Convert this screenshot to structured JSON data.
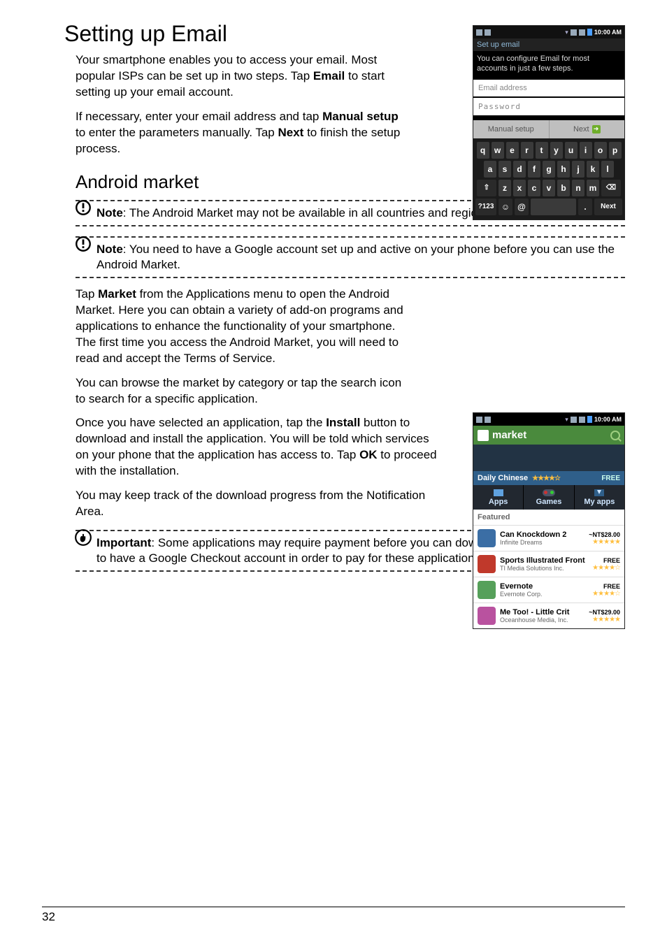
{
  "heading1": "Setting up Email",
  "email_p1_a": "Your smartphone enables you to access your email. Most popular ISPs can be set up in two steps. Tap ",
  "email_p1_b": "Email",
  "email_p1_c": " to start setting up your email account.",
  "email_p2_a": "If necessary, enter your email address and tap ",
  "email_p2_b": "Manual setup",
  "email_p2_c": " to enter the parameters manually. Tap ",
  "email_p2_d": "Next",
  "email_p2_e": " to finish the setup process.",
  "heading2": "Android market",
  "note1_label": "Note",
  "note1_body": ": The Android Market may not be available in all countries and regions.",
  "note2_label": "Note",
  "note2_body": ": You need to have a Google account set up and active on your phone before you can use the Android Market.",
  "market_p1_a": "Tap ",
  "market_p1_b": "Market",
  "market_p1_c": " from the Applications menu to open the Android Market. Here you can obtain a variety of add-on programs and applications to enhance the functionality of your smartphone. The first time you access the Android Market, you will need to read and accept the Terms of Service.",
  "market_p2": "You can browse the market by category or tap the search icon to search for a specific application.",
  "market_p3_a": "Once you have selected an application, tap the ",
  "market_p3_b": "Install",
  "market_p3_c": " button to download and install the application. You will be told which services on your phone that the application has access to. Tap ",
  "market_p3_d": "OK",
  "market_p3_e": " to proceed with the installation.",
  "market_p4": "You may keep track of the download progress from the Notification Area.",
  "important_label": "Important",
  "important_body": ": Some applications may require payment before you can download them. You will need to have a Google Checkout account in order to pay for these applications.",
  "page_number": "32",
  "phone1": {
    "time": "10:00 AM",
    "screen_title": "Set up email",
    "screen_msg": "You can configure Email for most accounts in just a few steps.",
    "field_email": "Email address",
    "field_password": "Password",
    "btn_manual": "Manual setup",
    "btn_next": "Next",
    "kbd": {
      "row1": [
        "q",
        "w",
        "e",
        "r",
        "t",
        "y",
        "u",
        "i",
        "o",
        "p"
      ],
      "row2": [
        "a",
        "s",
        "d",
        "f",
        "g",
        "h",
        "j",
        "k",
        "l"
      ],
      "row3": [
        "z",
        "x",
        "c",
        "v",
        "b",
        "n",
        "m"
      ],
      "sym": "?123",
      "at": "@",
      "period": ".",
      "next": "Next"
    }
  },
  "phone2": {
    "time": "10:00 AM",
    "title": "market",
    "feature": {
      "name": "Daily Chinese",
      "stars": "★★★★☆",
      "price": "FREE"
    },
    "tabs": {
      "apps": "Apps",
      "games": "Games",
      "myapps": "My apps"
    },
    "featured_label": "Featured",
    "apps": [
      {
        "name": "Can Knockdown 2",
        "publisher": "Infinite Dreams",
        "price": "~NT$28.00",
        "stars": "★★★★★",
        "color": "#3b6ea5"
      },
      {
        "name": "Sports Illustrated Front",
        "publisher": "TI Media Solutions Inc.",
        "price": "FREE",
        "stars": "★★★★☆",
        "color": "#c0392b"
      },
      {
        "name": "Evernote",
        "publisher": "Evernote Corp.",
        "price": "FREE",
        "stars": "★★★★☆",
        "color": "#56a05a"
      },
      {
        "name": "Me Too! - Little Crit",
        "publisher": "Oceanhouse Media, Inc.",
        "price": "~NT$29.00",
        "stars": "★★★★★",
        "color": "#b9529f"
      }
    ]
  }
}
